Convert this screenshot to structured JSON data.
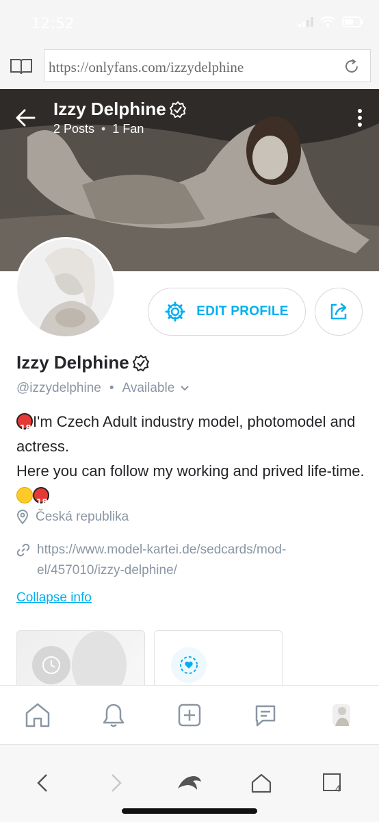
{
  "status_bar": {
    "time": "12:52"
  },
  "browser": {
    "url": "https://onlyfans.com/izzydelphine"
  },
  "cover": {
    "name": "Izzy Delphine",
    "posts": "2 Posts",
    "fans": "1 Fan",
    "separator": "•"
  },
  "actions": {
    "edit_profile": "EDIT PROFILE"
  },
  "profile": {
    "name": "Izzy Delphine",
    "handle": "@izzydelphine",
    "separator": "•",
    "availability": "Available",
    "bio_line1": "I'm Czech Adult industry model, photomodel and actress.",
    "bio_line2": "Here you can follow my working and prived life-time.",
    "location": "Česká republika",
    "website": "https://www.model-kartei.de/sedcards/mod-el/457010/izzy-delphine/",
    "collapse": "Collapse info"
  },
  "bottom_nav": [
    "home-icon",
    "bell-icon",
    "add-post-icon",
    "messages-icon",
    "avatar"
  ],
  "safari_nav": {
    "tab_count": "4"
  },
  "colors": {
    "accent": "#00aff0",
    "muted": "#8a96a3",
    "text": "#242529"
  }
}
